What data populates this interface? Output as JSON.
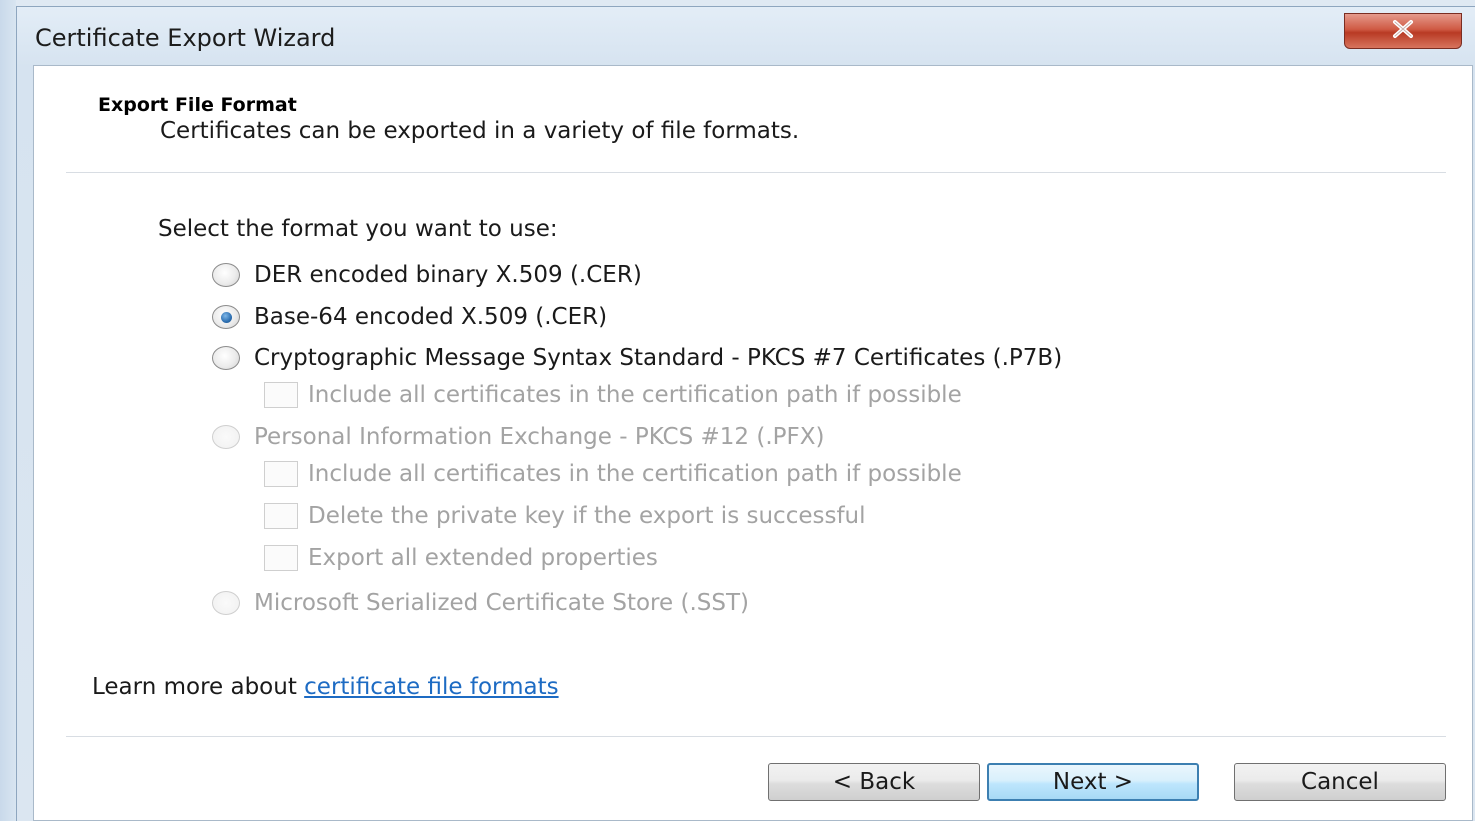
{
  "window": {
    "title": "Certificate Export Wizard"
  },
  "header": {
    "title": "Export File Format",
    "subtitle": "Certificates can be exported in a variety of file formats."
  },
  "body": {
    "prompt": "Select the format you want to use:",
    "options": [
      {
        "label": "DER encoded binary X.509 (.CER)",
        "checked": false,
        "enabled": true
      },
      {
        "label": "Base-64 encoded X.509 (.CER)",
        "checked": true,
        "enabled": true
      },
      {
        "label": "Cryptographic Message Syntax Standard - PKCS #7 Certificates (.P7B)",
        "checked": false,
        "enabled": true
      },
      {
        "label": "Personal Information Exchange - PKCS #12 (.PFX)",
        "checked": false,
        "enabled": false
      },
      {
        "label": "Microsoft Serialized Certificate Store (.SST)",
        "checked": false,
        "enabled": false
      }
    ],
    "p7b_checkboxes": [
      {
        "label": "Include all certificates in the certification path if possible",
        "checked": false,
        "enabled": false
      }
    ],
    "pfx_checkboxes": [
      {
        "label": "Include all certificates in the certification path if possible",
        "checked": false,
        "enabled": false
      },
      {
        "label": "Delete the private key if the export is successful",
        "checked": false,
        "enabled": false
      },
      {
        "label": "Export all extended properties",
        "checked": false,
        "enabled": false
      }
    ]
  },
  "learn_more": {
    "prefix": "Learn more about ",
    "link": "certificate file formats"
  },
  "buttons": {
    "back": "< Back",
    "next": "Next >",
    "cancel": "Cancel"
  },
  "colors": {
    "link": "#1d6bc3",
    "close_button": "#c74a33",
    "radio_selected": "#2d6fb1"
  },
  "icons": {
    "close": "close-icon"
  }
}
